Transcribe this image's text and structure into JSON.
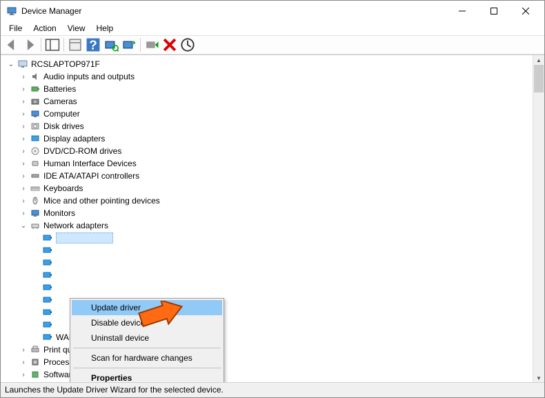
{
  "window": {
    "title": "Device Manager"
  },
  "menubar": [
    "File",
    "Action",
    "View",
    "Help"
  ],
  "tree": {
    "root": "RCSLAPTOP971F",
    "categories": [
      "Audio inputs and outputs",
      "Batteries",
      "Cameras",
      "Computer",
      "Disk drives",
      "Display adapters",
      "DVD/CD-ROM drives",
      "Human Interface Devices",
      "IDE ATA/ATAPI controllers",
      "Keyboards",
      "Mice and other pointing devices",
      "Monitors"
    ],
    "expanded_category": "Network adapters",
    "visible_children_last": "WAN Miniport (SSTP)",
    "after": [
      "Print queues",
      "Processors",
      "Software devices"
    ]
  },
  "context_menu": {
    "items": [
      "Update driver",
      "Disable device",
      "Uninstall device",
      "Scan for hardware changes",
      "Properties"
    ],
    "highlighted": "Update driver",
    "default": "Properties"
  },
  "statusbar": "Launches the Update Driver Wizard for the selected device."
}
